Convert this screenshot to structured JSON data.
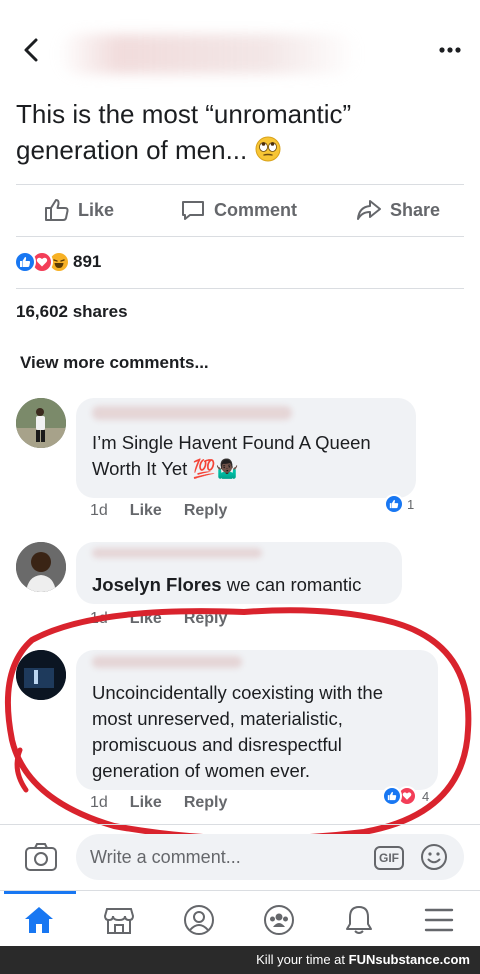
{
  "post": {
    "text": "This is the most “unromantic” generation of men..."
  },
  "actions": {
    "like": "Like",
    "comment": "Comment",
    "share": "Share"
  },
  "stats": {
    "reaction_count": "891",
    "shares": "16,602 shares"
  },
  "comments_section": {
    "view_more": "View more comments..."
  },
  "comments": [
    {
      "text_lines": [
        "I’m Single Havent Found A Queen",
        "Worth It Yet 💯🤷🏿‍♂️"
      ],
      "time": "1d",
      "like": "Like",
      "reply": "Reply",
      "reaction_count": "1"
    },
    {
      "mention": "Joselyn Flores",
      "text": " we can romantic",
      "time": "1d",
      "like": "Like",
      "reply": "Reply"
    },
    {
      "text_lines": [
        "Uncoincidentally coexisting with the",
        "most unreserved, materialistic,",
        "promiscuous and disrespectful",
        "generation of women ever."
      ],
      "time": "1d",
      "like": "Like",
      "reply": "Reply",
      "reaction_count": "4"
    }
  ],
  "composer": {
    "placeholder": "Write a comment...",
    "gif_label": "GIF"
  },
  "tabs": [
    "home-icon",
    "marketplace-icon",
    "profile-icon",
    "groups-icon",
    "notifications-icon",
    "menu-icon"
  ],
  "watermark": {
    "text": "Kill your time at ",
    "brand": "FUNsubstance.com"
  },
  "colors": {
    "facebook_blue": "#1877f2",
    "love_red": "#f33e58",
    "haha_yellow": "#f7b125",
    "circle_red": "#d9232d",
    "bubble_bg": "#f0f2f5",
    "secondary_text": "#65676b"
  }
}
